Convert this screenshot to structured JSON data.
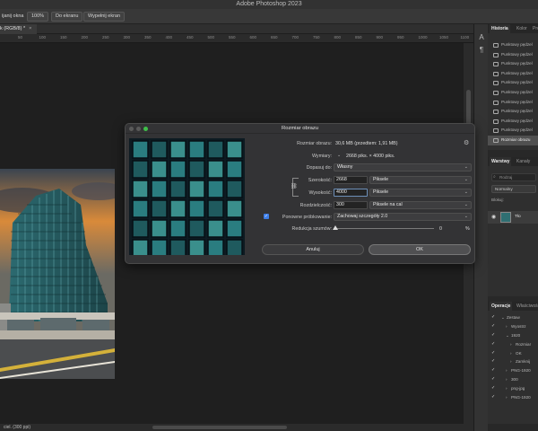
{
  "app": {
    "title": "Adobe Photoshop 2023"
  },
  "optionsbar": {
    "label_fit": "ijanij okna",
    "zoom_btn": "100%",
    "fit_screen_btn": "Do ekranu",
    "fill_screen_btn": "Wypełnij ekran"
  },
  "document": {
    "tab_title": "k (RGB/8) *",
    "status_text": "ciel. (300 ppi)",
    "ruler_ticks": [
      "50",
      "100",
      "150",
      "200",
      "250",
      "300",
      "350",
      "400",
      "450",
      "500",
      "550",
      "600",
      "650",
      "700",
      "750",
      "800",
      "850",
      "900",
      "950",
      "1000",
      "1050",
      "1100"
    ]
  },
  "panels": {
    "history": {
      "tabs": [
        "Historia",
        "Kolor",
        "Próbki"
      ],
      "items": [
        "Punktowy pędzel",
        "Punktowy pędzel",
        "Punktowy pędzel",
        "Punktowy pędzel",
        "Punktowy pędzel",
        "Punktowy pędzel",
        "Punktowy pędzel",
        "Punktowy pędzel",
        "Punktowy pędzel",
        "Punktowy pędzel",
        "Rozmiar obrazu"
      ]
    },
    "layers": {
      "tabs": [
        "Warstwy",
        "Kanały"
      ],
      "search_placeholder": "Rodzaj",
      "blend_mode": "Normalny",
      "lock_label": "Blokuj:",
      "layer_name": "Tło"
    },
    "actions": {
      "tabs": [
        "Operacje",
        "Właściwości"
      ],
      "items": [
        {
          "label": "Zestaw",
          "indent": 1,
          "expanded": true
        },
        {
          "label": "Wyostrz",
          "indent": 2,
          "expanded": false
        },
        {
          "label": "1920",
          "indent": 2,
          "expanded": true
        },
        {
          "label": "Rozmiar",
          "indent": 3,
          "expanded": false
        },
        {
          "label": "OK",
          "indent": 3,
          "expanded": false
        },
        {
          "label": "Zamknij",
          "indent": 3,
          "expanded": false
        },
        {
          "label": "PNG-1920",
          "indent": 2,
          "expanded": false
        },
        {
          "label": "300",
          "indent": 2,
          "expanded": false
        },
        {
          "label": "png-jpg",
          "indent": 2,
          "expanded": false
        },
        {
          "label": "PNG-1920",
          "indent": 2,
          "expanded": false
        }
      ]
    }
  },
  "dialog": {
    "title": "Rozmiar obrazu",
    "size_label": "Rozmiar obrazu:",
    "size_value": "30,6 MB (przedtem: 1,91 MB)",
    "dims_label": "Wymiary:",
    "dims_value": "2668 piks. × 4000 piks.",
    "fit_label": "Dopasuj do:",
    "fit_value": "Własny",
    "width_label": "Szerokość:",
    "width_value": "2668",
    "width_unit": "Piksele",
    "height_label": "Wysokość:",
    "height_value": "4000",
    "height_unit": "Piksele",
    "res_label": "Rozdzielczość:",
    "res_value": "300",
    "res_unit": "Piksele na cal",
    "resample_label": "Ponowne próbkowanie:",
    "resample_value": "Zachowaj szczegóły 2.0",
    "noise_label": "Redukcja szumów:",
    "noise_value": "0",
    "noise_unit": "%",
    "cancel_button": "Anuluj",
    "ok_button": "OK"
  }
}
